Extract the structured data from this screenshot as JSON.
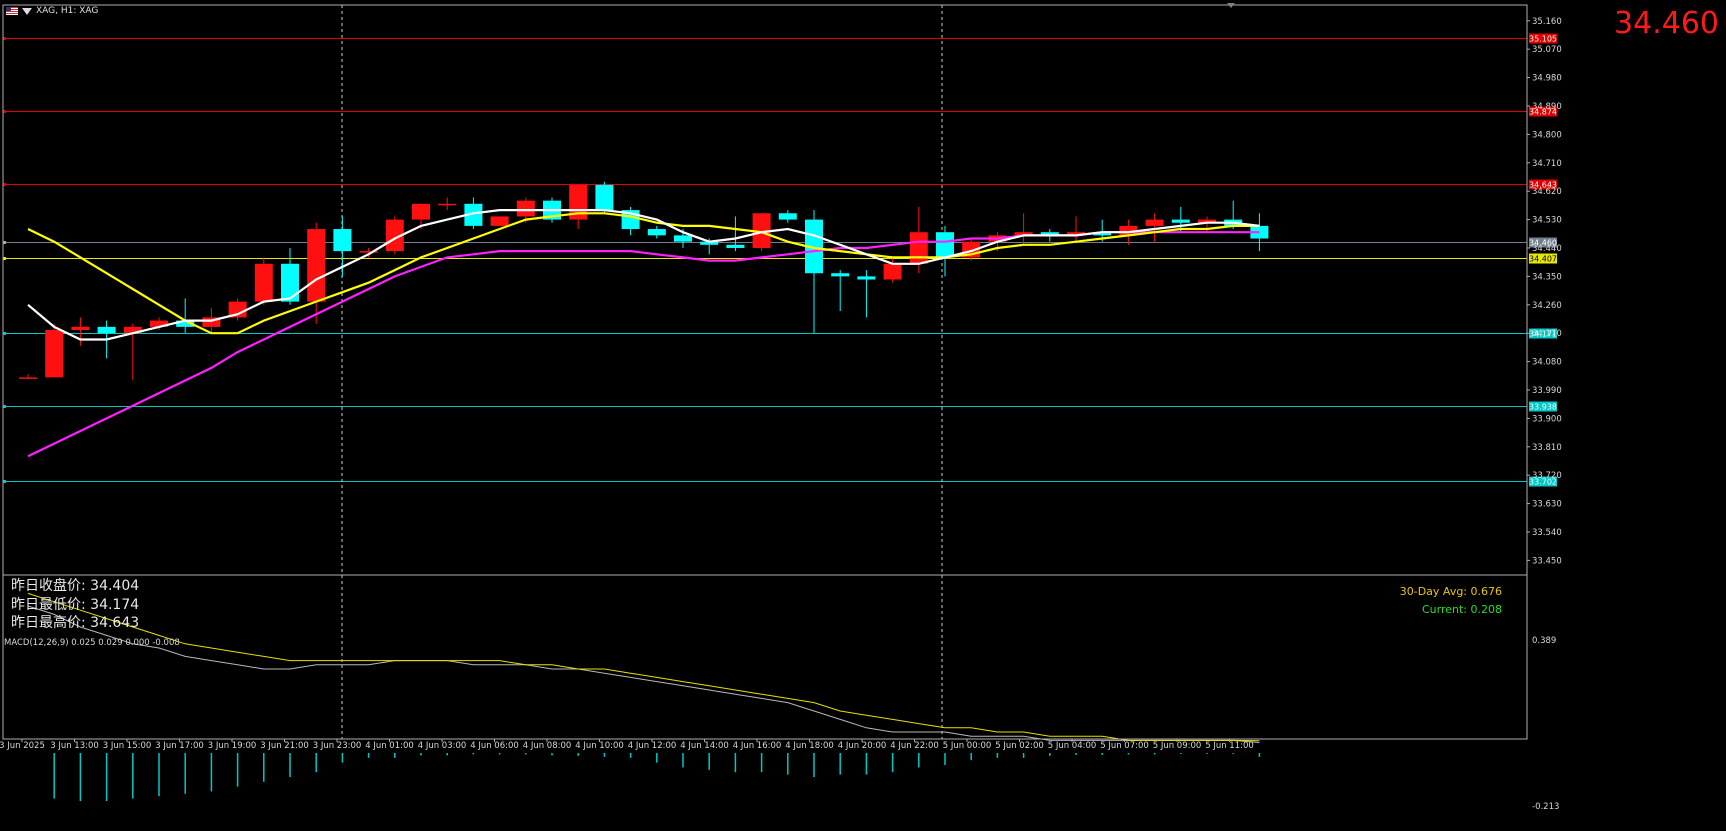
{
  "header": {
    "title": "XAG, H1: XAG",
    "big_price": "34.460"
  },
  "stats": {
    "prev_close": "昨日收盘价: 34.404",
    "prev_low": "昨日最低价: 34.174",
    "prev_high": "昨日最高价: 34.643"
  },
  "volatility": {
    "avg": "30-Day Avg: 0.676",
    "current": "Current: 0.208",
    "avg_color": "#e8c800",
    "current_color": "#22e022"
  },
  "colors": {
    "bull": "#ff1010",
    "bear": "#00ffff",
    "ma_white": "#ffffff",
    "ma_yellow": "#ffff00",
    "ma_magenta": "#ff20ff",
    "red_level": "#e00000",
    "cyan_level": "#00c8c8",
    "yellow_level": "#e8e800",
    "current_level": "#708090"
  },
  "chart_data": [
    {
      "type": "candlestick",
      "symbol": "XAG",
      "timeframe": "H1",
      "y_ticks": [
        35.16,
        35.07,
        34.98,
        34.89,
        34.8,
        34.71,
        34.62,
        34.53,
        34.44,
        34.35,
        34.26,
        34.17,
        34.08,
        33.99,
        33.9,
        33.81,
        33.72,
        33.63,
        33.54,
        33.45
      ],
      "y_tick_labels": [
        "35.160",
        "35.070",
        "34.980",
        "34.890",
        "34.800",
        "34.710",
        "34.620",
        "34.530",
        "34.440",
        "34.350",
        "34.260",
        "34.170",
        "34.080",
        "33.990",
        "33.900",
        "33.810",
        "33.720",
        "33.630",
        "33.540",
        "33.450"
      ],
      "ylim": [
        33.41,
        35.21
      ],
      "x_labels": [
        "3 Jun 2025",
        "3 Jun 13:00",
        "3 Jun 15:00",
        "3 Jun 17:00",
        "3 Jun 19:00",
        "3 Jun 21:00",
        "3 Jun 23:00",
        "4 Jun 01:00",
        "4 Jun 03:00",
        "4 Jun 06:00",
        "4 Jun 08:00",
        "4 Jun 10:00",
        "4 Jun 12:00",
        "4 Jun 14:00",
        "4 Jun 16:00",
        "4 Jun 18:00",
        "4 Jun 20:00",
        "4 Jun 22:00",
        "5 Jun 00:00",
        "5 Jun 02:00",
        "5 Jun 04:00",
        "5 Jun 07:00",
        "5 Jun 09:00",
        "5 Jun 11:00"
      ],
      "candles": [
        {
          "o": 34.03,
          "h": 34.04,
          "l": 34.03,
          "c": 34.03
        },
        {
          "o": 34.03,
          "h": 34.2,
          "l": 34.03,
          "c": 34.18
        },
        {
          "o": 34.18,
          "h": 34.22,
          "l": 34.13,
          "c": 34.19
        },
        {
          "o": 34.19,
          "h": 34.21,
          "l": 34.09,
          "c": 34.17
        },
        {
          "o": 34.17,
          "h": 34.2,
          "l": 34.02,
          "c": 34.19
        },
        {
          "o": 34.19,
          "h": 34.22,
          "l": 34.18,
          "c": 34.21
        },
        {
          "o": 34.21,
          "h": 34.28,
          "l": 34.17,
          "c": 34.19
        },
        {
          "o": 34.19,
          "h": 34.25,
          "l": 34.17,
          "c": 34.22
        },
        {
          "o": 34.22,
          "h": 34.28,
          "l": 34.21,
          "c": 34.27
        },
        {
          "o": 34.27,
          "h": 34.41,
          "l": 34.26,
          "c": 34.39
        },
        {
          "o": 34.39,
          "h": 34.44,
          "l": 34.26,
          "c": 34.27
        },
        {
          "o": 34.27,
          "h": 34.52,
          "l": 34.2,
          "c": 34.5
        },
        {
          "o": 34.5,
          "h": 34.54,
          "l": 34.35,
          "c": 34.43
        },
        {
          "o": 34.43,
          "h": 34.44,
          "l": 34.41,
          "c": 34.43
        },
        {
          "o": 34.43,
          "h": 34.54,
          "l": 34.42,
          "c": 34.53
        },
        {
          "o": 34.53,
          "h": 34.58,
          "l": 34.5,
          "c": 34.58
        },
        {
          "o": 34.58,
          "h": 34.6,
          "l": 34.56,
          "c": 34.58
        },
        {
          "o": 34.58,
          "h": 34.6,
          "l": 34.5,
          "c": 34.51
        },
        {
          "o": 34.51,
          "h": 34.54,
          "l": 34.51,
          "c": 34.54
        },
        {
          "o": 34.54,
          "h": 34.6,
          "l": 34.52,
          "c": 34.59
        },
        {
          "o": 34.59,
          "h": 34.6,
          "l": 34.52,
          "c": 34.53
        },
        {
          "o": 34.53,
          "h": 34.64,
          "l": 34.5,
          "c": 34.64
        },
        {
          "o": 34.64,
          "h": 34.65,
          "l": 34.55,
          "c": 34.56
        },
        {
          "o": 34.56,
          "h": 34.57,
          "l": 34.48,
          "c": 34.5
        },
        {
          "o": 34.5,
          "h": 34.51,
          "l": 34.47,
          "c": 34.48
        },
        {
          "o": 34.48,
          "h": 34.5,
          "l": 34.44,
          "c": 34.46
        },
        {
          "o": 34.46,
          "h": 34.47,
          "l": 34.42,
          "c": 34.45
        },
        {
          "o": 34.45,
          "h": 34.54,
          "l": 34.43,
          "c": 34.44
        },
        {
          "o": 34.44,
          "h": 34.55,
          "l": 34.43,
          "c": 34.55
        },
        {
          "o": 34.55,
          "h": 34.56,
          "l": 34.52,
          "c": 34.53
        },
        {
          "o": 34.53,
          "h": 34.56,
          "l": 34.17,
          "c": 34.36
        },
        {
          "o": 34.36,
          "h": 34.37,
          "l": 34.24,
          "c": 34.35
        },
        {
          "o": 34.35,
          "h": 34.37,
          "l": 34.22,
          "c": 34.34
        },
        {
          "o": 34.34,
          "h": 34.41,
          "l": 34.33,
          "c": 34.39
        },
        {
          "o": 34.39,
          "h": 34.57,
          "l": 34.36,
          "c": 34.49
        },
        {
          "o": 34.49,
          "h": 34.51,
          "l": 34.35,
          "c": 34.41
        },
        {
          "o": 34.41,
          "h": 34.47,
          "l": 34.4,
          "c": 34.46
        },
        {
          "o": 34.46,
          "h": 34.49,
          "l": 34.43,
          "c": 34.48
        },
        {
          "o": 34.48,
          "h": 34.55,
          "l": 34.45,
          "c": 34.49
        },
        {
          "o": 34.49,
          "h": 34.5,
          "l": 34.46,
          "c": 34.48
        },
        {
          "o": 34.48,
          "h": 34.54,
          "l": 34.46,
          "c": 34.49
        },
        {
          "o": 34.49,
          "h": 34.53,
          "l": 34.46,
          "c": 34.48
        },
        {
          "o": 34.48,
          "h": 34.53,
          "l": 34.45,
          "c": 34.51
        },
        {
          "o": 34.51,
          "h": 34.55,
          "l": 34.46,
          "c": 34.53
        },
        {
          "o": 34.53,
          "h": 34.57,
          "l": 34.49,
          "c": 34.52
        },
        {
          "o": 34.52,
          "h": 34.54,
          "l": 34.49,
          "c": 34.53
        },
        {
          "o": 34.53,
          "h": 34.59,
          "l": 34.5,
          "c": 34.51
        },
        {
          "o": 34.51,
          "h": 34.55,
          "l": 34.43,
          "c": 34.47
        }
      ],
      "ma_white": [
        34.26,
        34.19,
        34.15,
        34.15,
        34.17,
        34.19,
        34.21,
        34.21,
        34.23,
        34.27,
        34.28,
        34.34,
        34.38,
        34.42,
        34.47,
        34.51,
        34.53,
        34.55,
        34.56,
        34.56,
        34.56,
        34.56,
        34.56,
        34.55,
        34.53,
        34.49,
        34.46,
        34.47,
        34.49,
        34.5,
        34.48,
        34.45,
        34.42,
        34.39,
        34.39,
        34.41,
        34.43,
        34.46,
        34.48,
        34.48,
        34.48,
        34.49,
        34.49,
        34.5,
        34.51,
        34.52,
        34.52,
        34.51
      ],
      "ma_yellow": [
        34.5,
        34.46,
        34.41,
        34.36,
        34.31,
        34.26,
        34.21,
        34.17,
        34.17,
        34.21,
        34.24,
        34.27,
        34.3,
        34.33,
        34.37,
        34.41,
        34.44,
        34.47,
        34.5,
        34.53,
        34.54,
        34.55,
        34.55,
        34.54,
        34.52,
        34.51,
        34.51,
        34.5,
        34.49,
        34.46,
        34.44,
        34.43,
        34.42,
        34.41,
        34.41,
        34.41,
        34.42,
        34.44,
        34.45,
        34.45,
        34.46,
        34.47,
        34.48,
        34.49,
        34.5,
        34.5,
        34.51,
        34.51
      ],
      "ma_magenta": [
        33.78,
        33.82,
        33.86,
        33.9,
        33.94,
        33.98,
        34.02,
        34.06,
        34.11,
        34.15,
        34.19,
        34.23,
        34.27,
        34.31,
        34.35,
        34.38,
        34.41,
        34.42,
        34.43,
        34.43,
        34.43,
        34.43,
        34.43,
        34.43,
        34.42,
        34.41,
        34.4,
        34.4,
        34.41,
        34.42,
        34.43,
        34.44,
        34.44,
        34.45,
        34.46,
        34.46,
        34.47,
        34.47,
        34.48,
        34.48,
        34.48,
        34.49,
        34.49,
        34.49,
        34.49,
        34.49,
        34.49,
        34.49
      ],
      "levels": [
        {
          "value": 35.105,
          "label": "35.105",
          "kind": "red"
        },
        {
          "value": 34.874,
          "label": "34.874",
          "kind": "red"
        },
        {
          "value": 34.643,
          "label": "34.643",
          "kind": "red"
        },
        {
          "value": 34.46,
          "label": "34.460",
          "kind": "current"
        },
        {
          "value": 34.407,
          "label": "34.407",
          "kind": "yellow"
        },
        {
          "value": 34.171,
          "label": "34.171",
          "kind": "cyan"
        },
        {
          "value": 33.938,
          "label": "33.938",
          "kind": "cyan"
        },
        {
          "value": 33.702,
          "label": "33.702",
          "kind": "cyan"
        }
      ]
    },
    {
      "type": "macd",
      "title": "MACD(12,26,9) 0.025 0.029 0.000 -0.008",
      "y_tick_labels": [
        "0.389",
        "-0.213"
      ],
      "ylim": [
        -0.213,
        0.389
      ],
      "histogram": [
        0.0,
        -0.095,
        -0.1,
        -0.1,
        -0.095,
        -0.09,
        -0.085,
        -0.08,
        -0.07,
        -0.06,
        -0.05,
        -0.04,
        -0.02,
        -0.01,
        -0.01,
        -0.005,
        -0.005,
        -0.003,
        -0.003,
        -0.003,
        -0.005,
        -0.006,
        -0.008,
        -0.01,
        -0.02,
        -0.03,
        -0.035,
        -0.04,
        -0.04,
        -0.045,
        -0.05,
        -0.045,
        -0.045,
        -0.04,
        -0.03,
        -0.025,
        -0.015,
        -0.01,
        -0.01,
        -0.006,
        -0.004,
        -0.004,
        -0.003,
        -0.003,
        -0.002,
        -0.002,
        -0.002,
        -0.008
      ],
      "macd_line": [
        0.35,
        0.33,
        0.3,
        0.28,
        0.26,
        0.25,
        0.23,
        0.22,
        0.21,
        0.2,
        0.2,
        0.21,
        0.21,
        0.21,
        0.22,
        0.22,
        0.22,
        0.21,
        0.21,
        0.21,
        0.2,
        0.2,
        0.19,
        0.18,
        0.17,
        0.16,
        0.15,
        0.14,
        0.13,
        0.12,
        0.1,
        0.08,
        0.06,
        0.05,
        0.05,
        0.05,
        0.04,
        0.04,
        0.04,
        0.03,
        0.03,
        0.03,
        0.03,
        0.03,
        0.03,
        0.03,
        0.03,
        0.025
      ],
      "signal_line": [
        0.38,
        0.36,
        0.34,
        0.32,
        0.3,
        0.28,
        0.26,
        0.25,
        0.24,
        0.23,
        0.22,
        0.22,
        0.22,
        0.22,
        0.22,
        0.22,
        0.22,
        0.22,
        0.22,
        0.21,
        0.21,
        0.2,
        0.2,
        0.19,
        0.18,
        0.17,
        0.16,
        0.15,
        0.14,
        0.13,
        0.12,
        0.1,
        0.09,
        0.08,
        0.07,
        0.06,
        0.06,
        0.05,
        0.05,
        0.04,
        0.04,
        0.04,
        0.03,
        0.03,
        0.03,
        0.03,
        0.03,
        0.029
      ]
    }
  ]
}
